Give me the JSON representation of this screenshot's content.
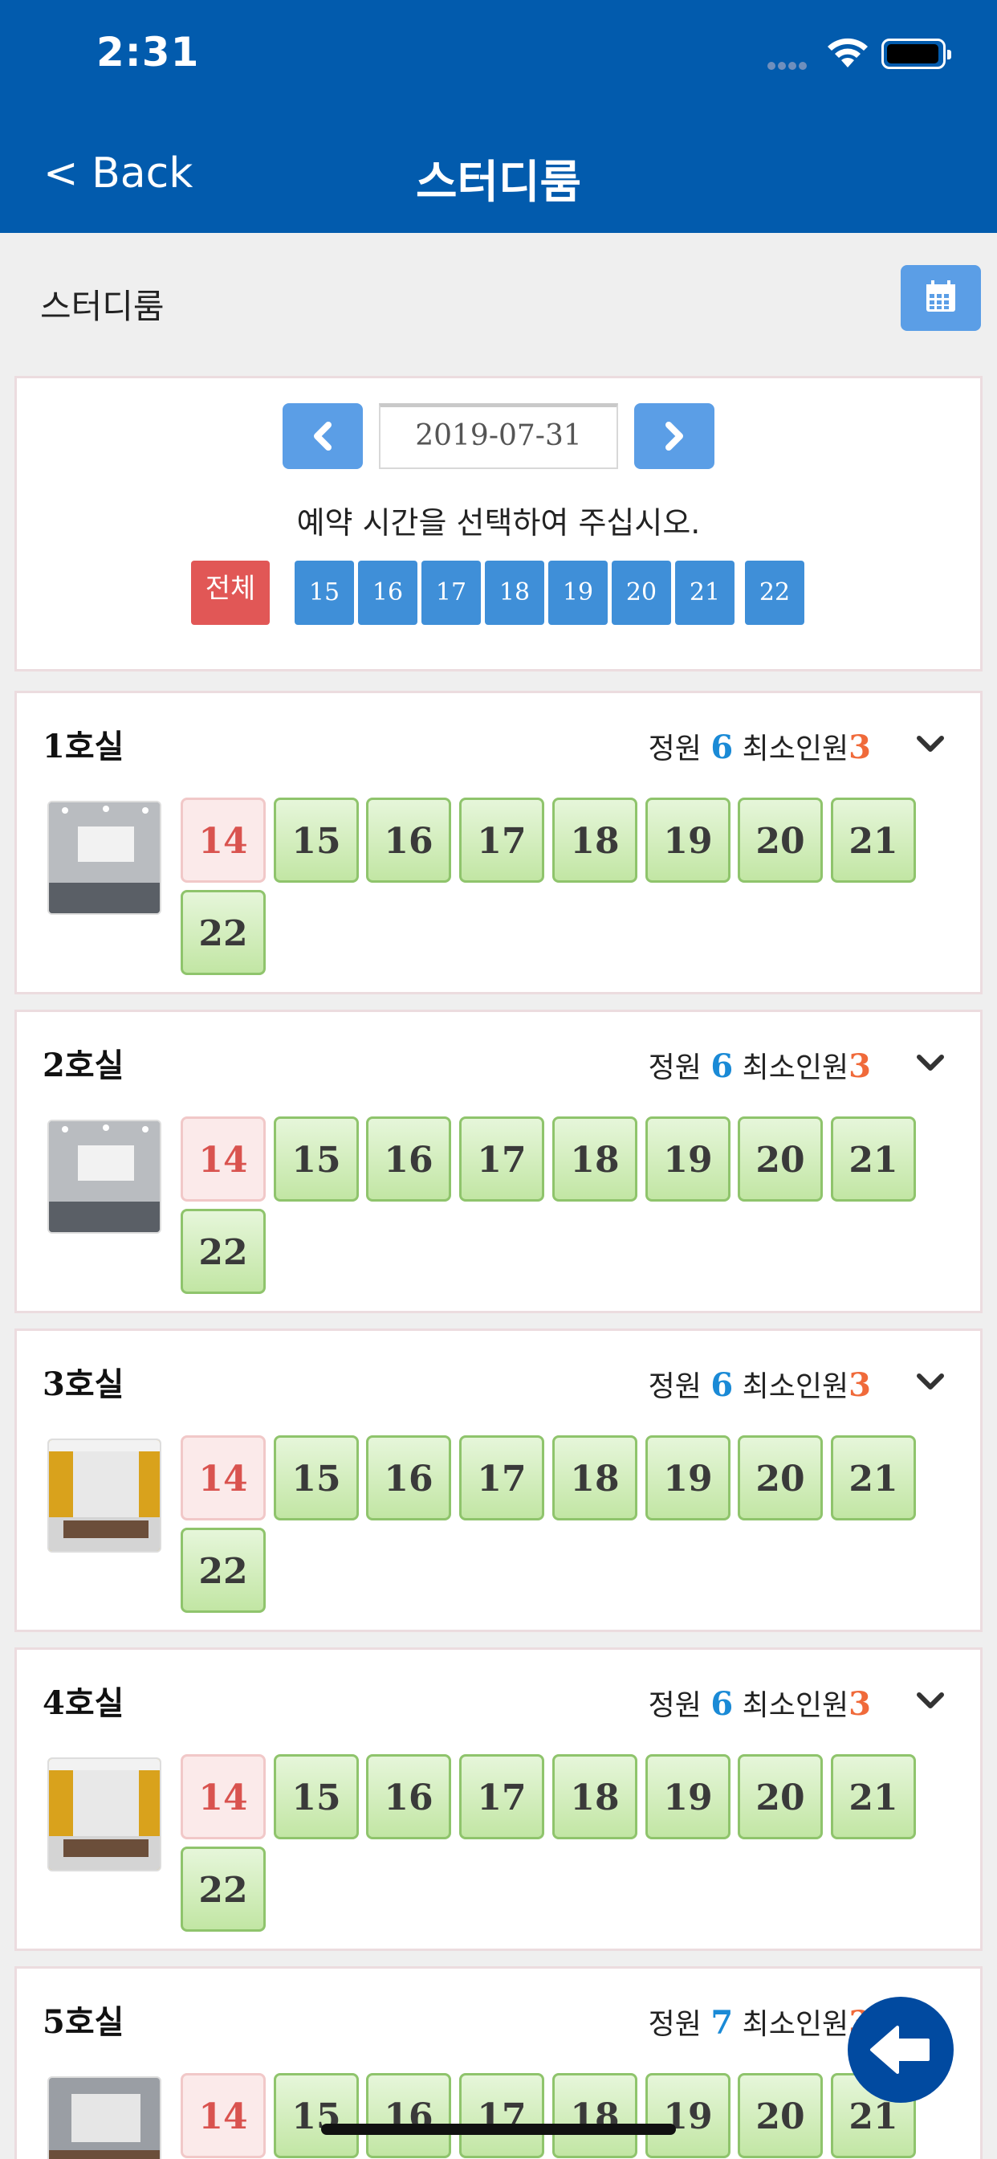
{
  "status_bar": {
    "time": "2:31"
  },
  "nav": {
    "back_label": "< Back",
    "title": "스터디룸"
  },
  "page": {
    "title": "스터디룸"
  },
  "date_selector": {
    "date": "2019-07-31",
    "prompt": "예약 시간을 선택하여 주십시오.",
    "all_label": "전체",
    "hours": [
      "15",
      "16",
      "17",
      "18",
      "19",
      "20",
      "21",
      "22"
    ]
  },
  "labels": {
    "capacity": "정원",
    "min_people": "최소인원"
  },
  "rooms": [
    {
      "name": "1호실",
      "capacity": "6",
      "min": "3",
      "booked": "14",
      "slots": [
        "15",
        "16",
        "17",
        "18",
        "19",
        "20",
        "21",
        "22"
      ]
    },
    {
      "name": "2호실",
      "capacity": "6",
      "min": "3",
      "booked": "14",
      "slots": [
        "15",
        "16",
        "17",
        "18",
        "19",
        "20",
        "21",
        "22"
      ]
    },
    {
      "name": "3호실",
      "capacity": "6",
      "min": "3",
      "booked": "14",
      "slots": [
        "15",
        "16",
        "17",
        "18",
        "19",
        "20",
        "21",
        "22"
      ]
    },
    {
      "name": "4호실",
      "capacity": "6",
      "min": "3",
      "booked": "14",
      "slots": [
        "15",
        "16",
        "17",
        "18",
        "19",
        "20",
        "21",
        "22"
      ]
    },
    {
      "name": "5호실",
      "capacity": "7",
      "min": "3",
      "booked": "14",
      "slots": [
        "15",
        "16",
        "17",
        "18",
        "19",
        "20",
        "21"
      ]
    }
  ],
  "colors": {
    "nav": "#025bad",
    "button_blue": "#5b9ee6",
    "hour_blue": "#3f8fd8",
    "all_red": "#e15756",
    "capacity_blue": "#1a8ad6",
    "min_orange": "#f06a3a"
  }
}
